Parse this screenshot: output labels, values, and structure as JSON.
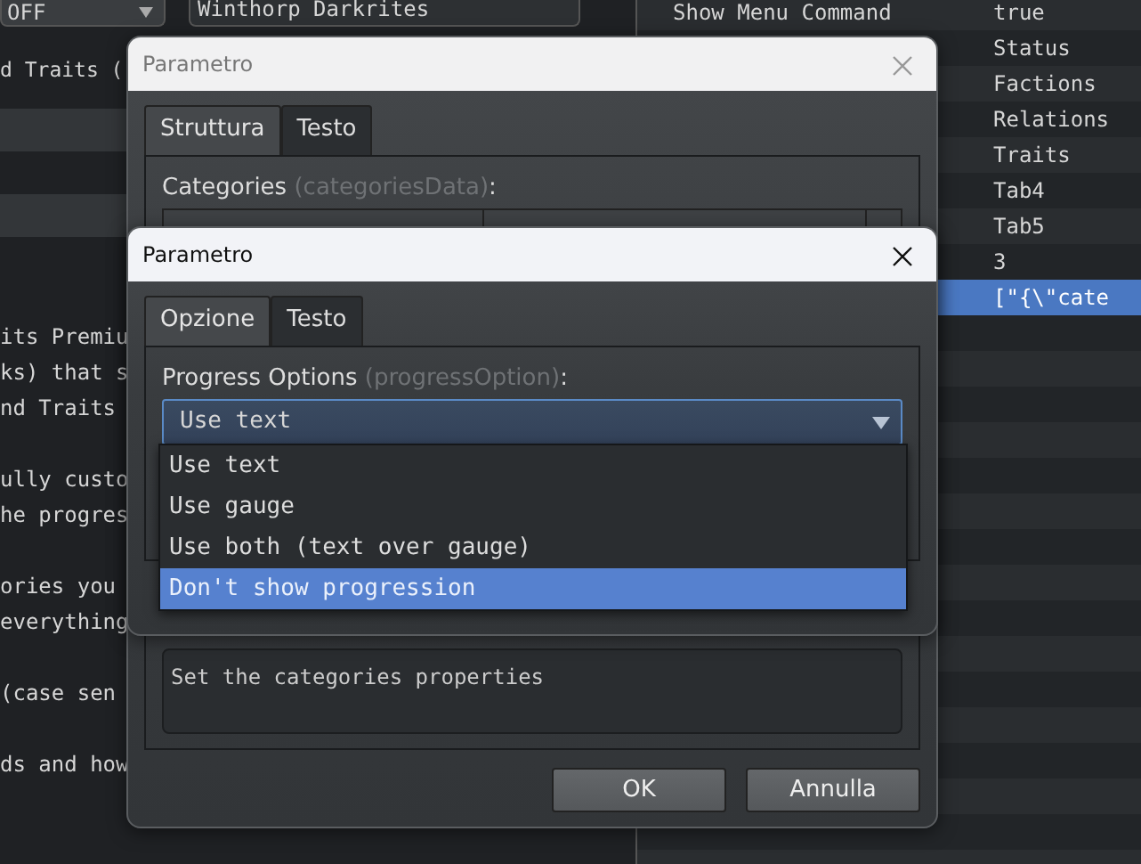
{
  "background": {
    "mode_select": {
      "value": "OFF"
    },
    "name_field": {
      "value": "Winthorp Darkrites"
    },
    "heading_fragment": "d Traits (",
    "help_paragraphs": [
      [
        "its Premiu",
        "ks) that s",
        "nd Traits"
      ],
      [
        "ully custo",
        "he progres"
      ],
      [
        "ories you",
        "everything"
      ],
      [
        "(case sen"
      ],
      [
        "ds and how"
      ]
    ],
    "parameters": [
      {
        "name": "Show Menu Command",
        "value": "true",
        "selected": false
      },
      {
        "value": "Status",
        "selected": false
      },
      {
        "value": "Factions",
        "selected": false
      },
      {
        "value": "Relations",
        "selected": false
      },
      {
        "value": "Traits",
        "selected": false
      },
      {
        "value": "Tab4",
        "selected": false
      },
      {
        "value": "Tab5",
        "selected": false
      },
      {
        "value": "3",
        "selected": false
      },
      {
        "value": "[\"{\\\"cate",
        "selected": true
      }
    ]
  },
  "outer_dialog": {
    "title": "Parametro",
    "active": false,
    "tabs": [
      {
        "label": "Struttura",
        "selected": true
      },
      {
        "label": "Testo",
        "selected": false
      }
    ],
    "field_label": "Categories",
    "field_key": "(categoriesData)",
    "field_suffix": ":",
    "description": "Set the categories properties",
    "buttons": [
      "OK",
      "Annulla"
    ]
  },
  "inner_dialog": {
    "title": "Parametro",
    "active": true,
    "tabs": [
      {
        "label": "Opzione",
        "selected": true
      },
      {
        "label": "Testo",
        "selected": false
      }
    ],
    "field_label": "Progress Options",
    "field_key": "(progressOption)",
    "field_suffix": ":",
    "select": {
      "value": "Use text",
      "expanded": true,
      "options": [
        {
          "label": "Use text",
          "highlighted": false
        },
        {
          "label": "Use gauge",
          "highlighted": false
        },
        {
          "label": "Use both (text over gauge)",
          "highlighted": false
        },
        {
          "label": "Don't show progression",
          "highlighted": true
        }
      ]
    }
  }
}
